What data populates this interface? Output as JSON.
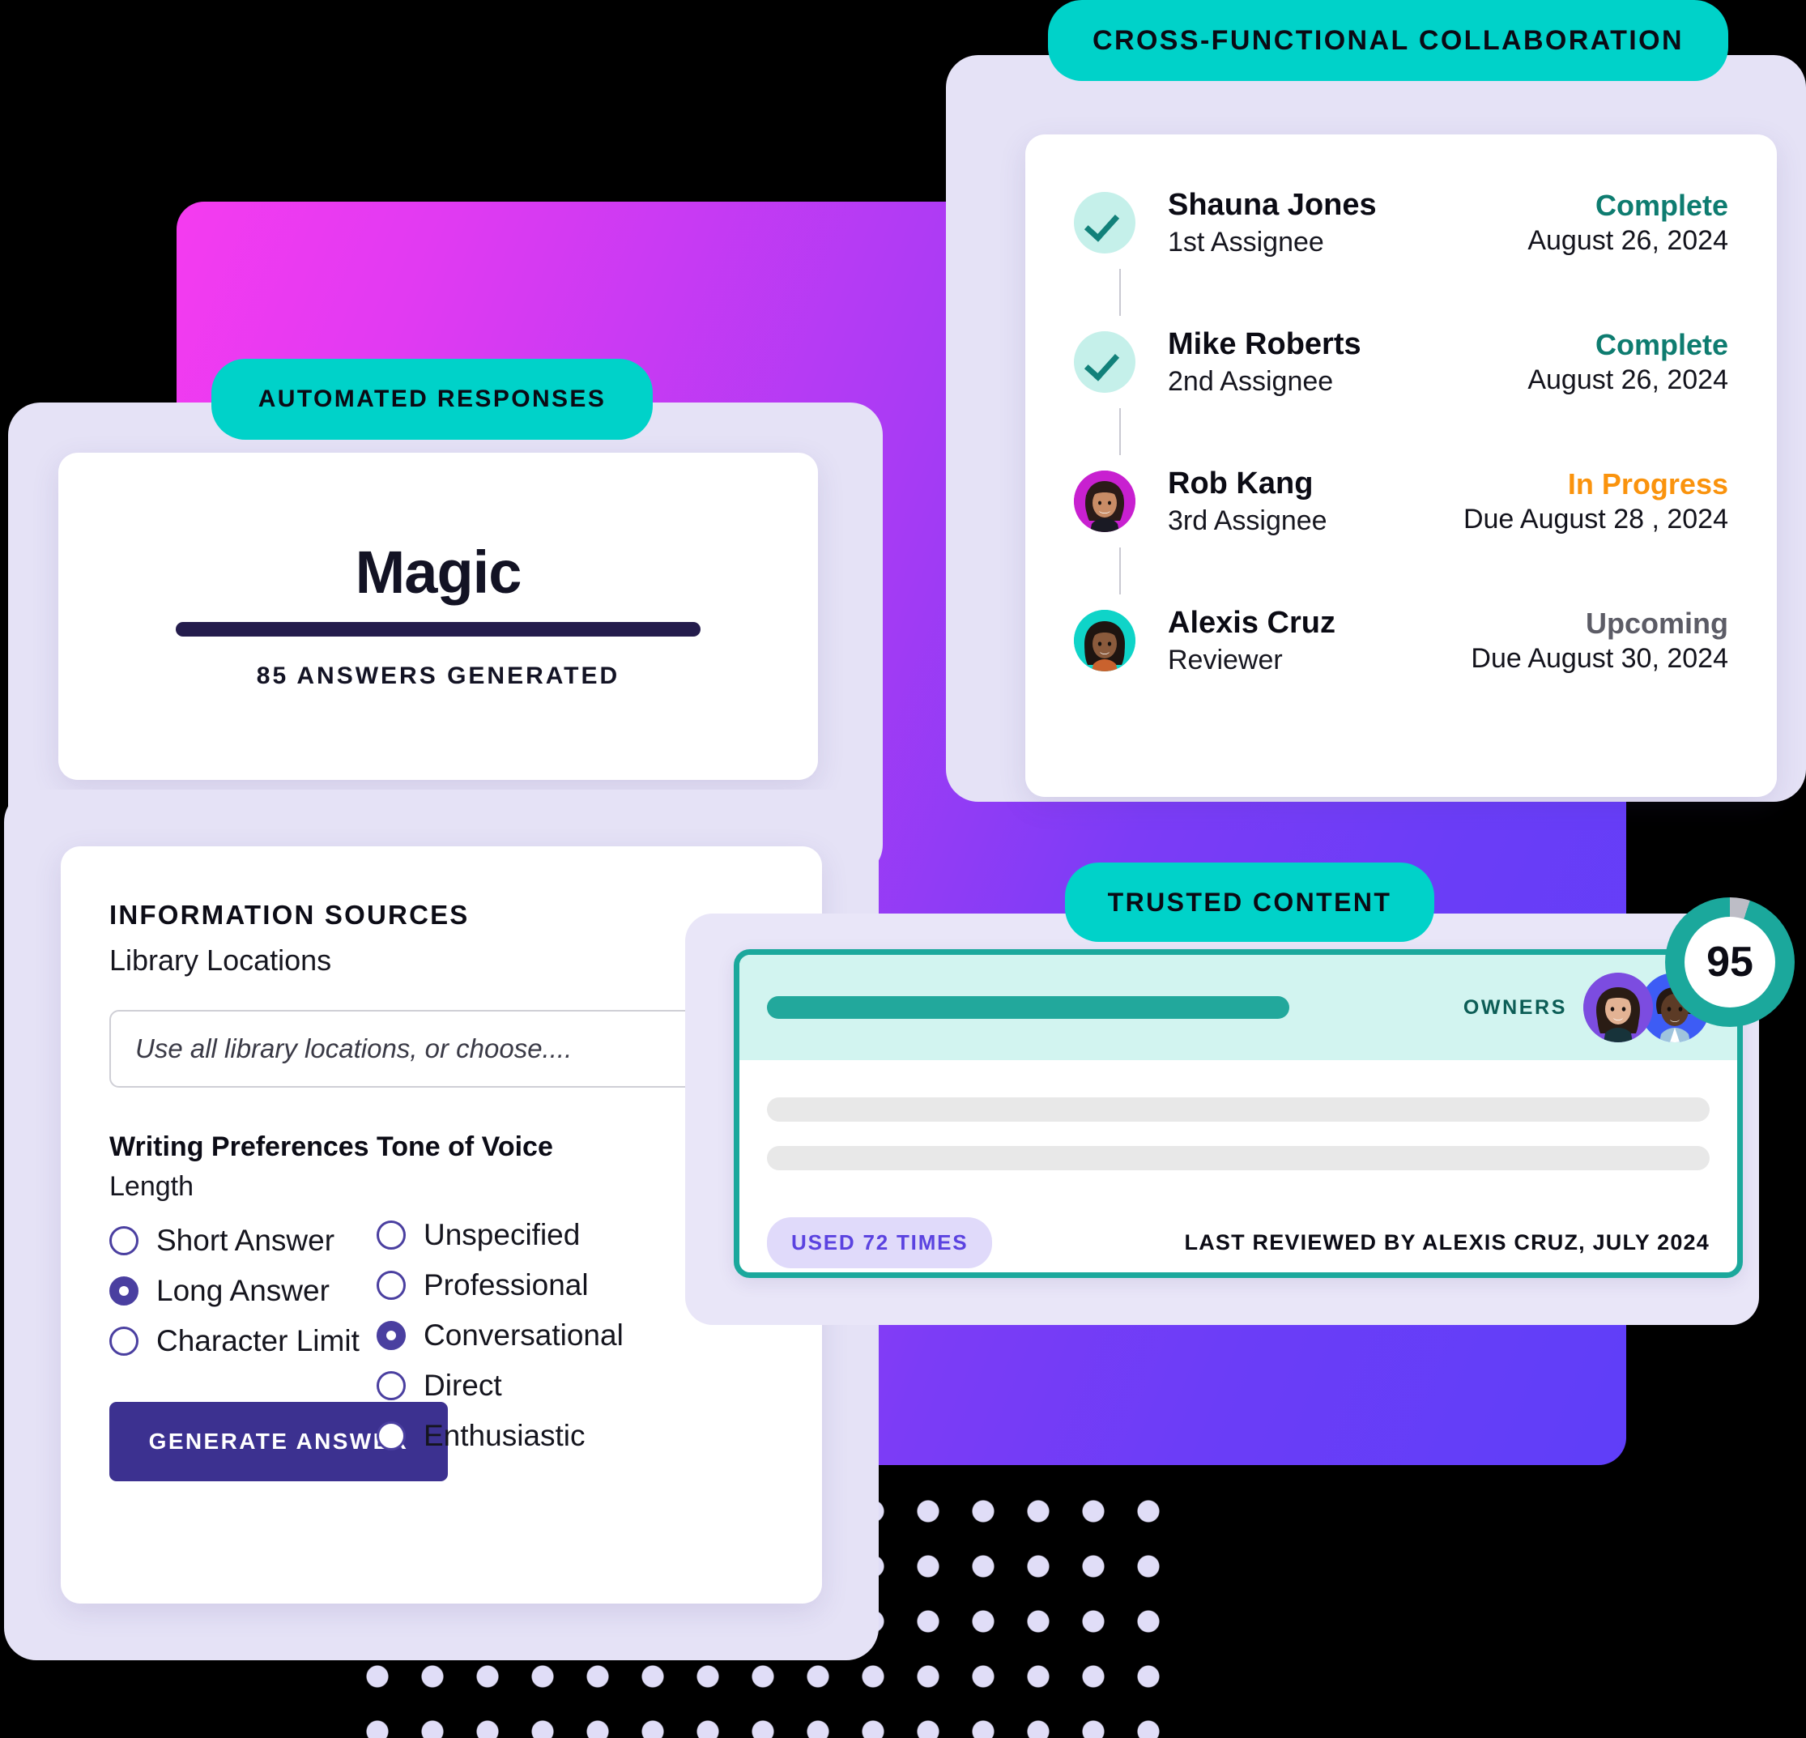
{
  "colors": {
    "teal": "#00D2C9",
    "teal_dark": "#1BA89C",
    "purple_button": "#3C3190",
    "accent_violet": "#5B43E0",
    "status_complete": "#0E7C70",
    "status_progress": "#FA930D",
    "status_upcoming": "#5C5C66",
    "gradient_start": "#F53BF0",
    "gradient_end": "#5F3EF8"
  },
  "automated_responses": {
    "pill_label": "AUTOMATED RESPONSES",
    "title": "Magic",
    "subtitle": "85 ANSWERS GENERATED"
  },
  "information_sources": {
    "kicker": "INFORMATION SOURCES",
    "subtitle": "Library Locations",
    "location_input": {
      "value": "",
      "placeholder": "Use all library locations, or choose...."
    },
    "writing_preferences": {
      "heading": "Writing Preferences",
      "sublabel": "Length",
      "options": [
        {
          "label": "Short Answer",
          "selected": false
        },
        {
          "label": "Long Answer",
          "selected": true
        },
        {
          "label": "Character Limit",
          "selected": false
        }
      ]
    },
    "tone_of_voice": {
      "heading": "Tone of Voice",
      "options": [
        {
          "label": "Unspecified",
          "selected": false
        },
        {
          "label": "Professional",
          "selected": false
        },
        {
          "label": "Conversational",
          "selected": true
        },
        {
          "label": "Direct",
          "selected": false
        },
        {
          "label": "Enthusiastic",
          "selected": false
        }
      ]
    },
    "generate_button": "GENERATE ANSWER"
  },
  "collaboration": {
    "pill_label": "CROSS-FUNCTIONAL COLLABORATION",
    "rows": [
      {
        "name": "Shauna Jones",
        "role": "1st Assignee",
        "status": "Complete",
        "status_kind": "complete",
        "date": "August 26, 2024",
        "avatar": "check-icon"
      },
      {
        "name": "Mike Roberts",
        "role": "2nd Assignee",
        "status": "Complete",
        "status_kind": "complete",
        "date": "August 26, 2024",
        "avatar": "check-icon"
      },
      {
        "name": "Rob Kang",
        "role": "3rd Assignee",
        "status": "In Progress",
        "status_kind": "progress",
        "date": "Due August 28 , 2024",
        "avatar": "photo-rob"
      },
      {
        "name": "Alexis Cruz",
        "role": "Reviewer",
        "status": "Upcoming",
        "status_kind": "upcoming",
        "date": "Due August 30, 2024",
        "avatar": "photo-alexis"
      }
    ]
  },
  "trusted_content": {
    "pill_label": "TRUSTED CONTENT",
    "owners_label": "OWNERS",
    "used_badge": "USED 72 TIMES",
    "last_reviewed": "LAST REVIEWED BY ALEXIS CRUZ, JULY 2024",
    "score": "95",
    "score_percent": 95
  }
}
